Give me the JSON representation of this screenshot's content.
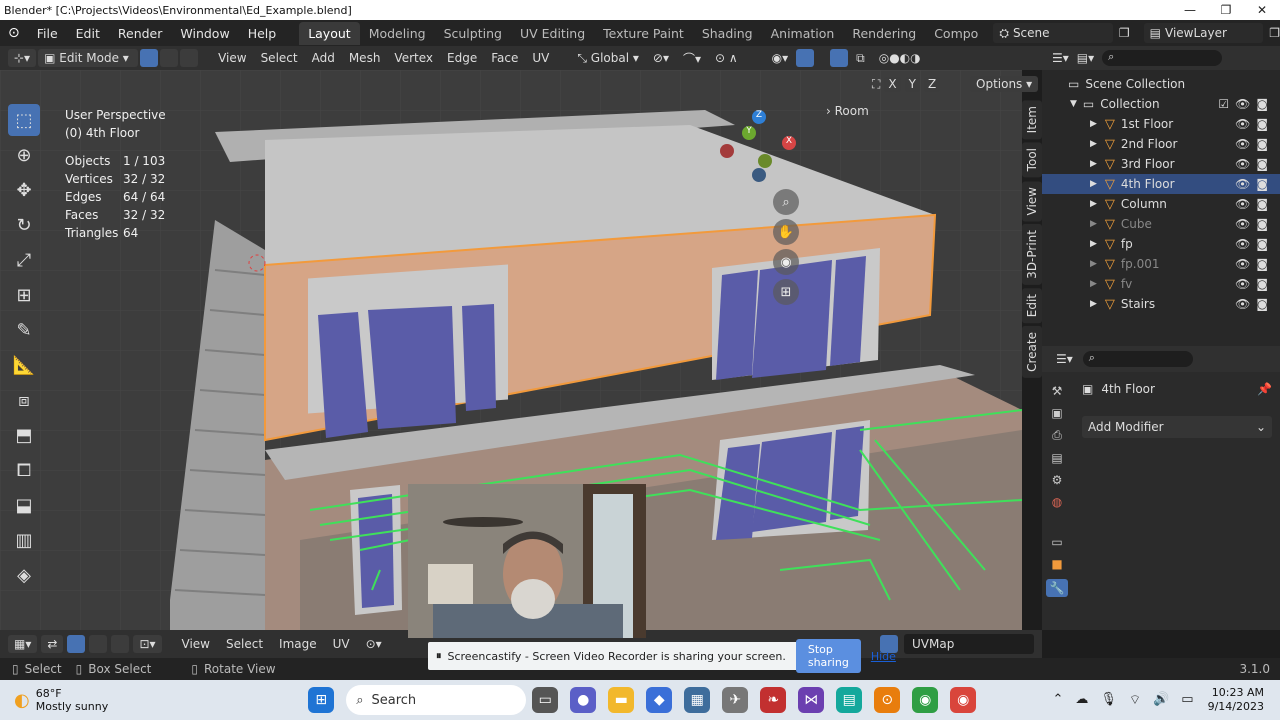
{
  "os_title": "Blender* [C:\\Projects\\Videos\\Environmental\\Ed_Example.blend]",
  "window_buttons": [
    "—",
    "❐",
    "✕"
  ],
  "menu": [
    "File",
    "Edit",
    "Render",
    "Window",
    "Help"
  ],
  "workspaces": [
    "Layout",
    "Modeling",
    "Sculpting",
    "UV Editing",
    "Texture Paint",
    "Shading",
    "Animation",
    "Rendering",
    "Compo"
  ],
  "scene": "Scene",
  "view_layer": "ViewLayer",
  "vp_header": {
    "mode": "Edit Mode",
    "menus": [
      "View",
      "Select",
      "Add",
      "Mesh",
      "Vertex",
      "Edge",
      "Face",
      "UV"
    ],
    "orientation": "Global",
    "options": "Options",
    "axes": [
      "X",
      "Y",
      "Z"
    ]
  },
  "viewport": {
    "perspective": "User Perspective",
    "object": "(0) 4th Floor",
    "stats": [
      [
        "Objects",
        "1 / 103"
      ],
      [
        "Vertices",
        "32 / 32"
      ],
      [
        "Edges",
        "64 / 64"
      ],
      [
        "Faces",
        "32 / 32"
      ],
      [
        "Triangles",
        "64"
      ]
    ],
    "room_label": "Room",
    "gizmo_axes": [
      "Z",
      "Y",
      "X"
    ],
    "side_tabs": [
      "Item",
      "Tool",
      "View",
      "3D-Print",
      "Edit",
      "Create"
    ]
  },
  "outliner": {
    "root": "Scene Collection",
    "collection": "Collection",
    "items": [
      {
        "name": "1st Floor",
        "dim": false
      },
      {
        "name": "2nd Floor",
        "dim": false
      },
      {
        "name": "3rd Floor",
        "dim": false
      },
      {
        "name": "4th Floor",
        "dim": false
      },
      {
        "name": "Column",
        "dim": false
      },
      {
        "name": "Cube",
        "dim": true
      },
      {
        "name": "fp",
        "dim": false
      },
      {
        "name": "fp.001",
        "dim": true
      },
      {
        "name": "fv",
        "dim": true
      },
      {
        "name": "Stairs",
        "dim": false
      }
    ]
  },
  "properties": {
    "object_name": "4th Floor",
    "add_modifier": "Add Modifier"
  },
  "uv_header": {
    "menus": [
      "View",
      "Select",
      "Image",
      "UV"
    ],
    "uvmap": "UVMap"
  },
  "status": {
    "select": "Select",
    "box_select": "Box Select",
    "rotate": "Rotate View",
    "version": "3.1.0"
  },
  "share_bar": {
    "text": "Screencastify - Screen Video Recorder is sharing your screen.",
    "stop": "Stop sharing",
    "hide": "Hide"
  },
  "taskbar": {
    "temp": "68°F",
    "weather": "Mostly sunny",
    "search": "Search",
    "time": "10:23 AM",
    "date": "9/14/2023"
  }
}
